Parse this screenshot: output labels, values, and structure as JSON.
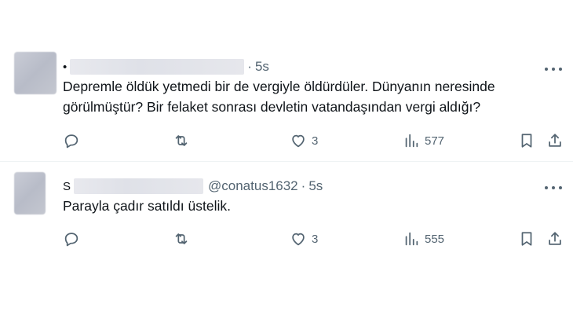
{
  "tweets": [
    {
      "author_initial": "•",
      "handle": "",
      "time": "5s",
      "lines": [
        "Depremle öldük yetmedi bir de vergiyle öldürdüler. Dünyanın neresinde",
        "görülmüştür? Bir felaket sonrası devletin vatandaşından vergi aldığı?"
      ],
      "likes": "3",
      "views": "577"
    },
    {
      "author_initial": "S",
      "handle": "@conatus1632",
      "time": "5s",
      "lines": [
        "Parayla çadır satıldı üstelik."
      ],
      "likes": "3",
      "views": "555"
    }
  ],
  "icons": {
    "reply": "reply-icon",
    "retweet": "retweet-icon",
    "like": "heart-icon",
    "views": "views-chart-icon",
    "bookmark": "bookmark-icon",
    "share": "share-icon",
    "more": "more-dots-icon"
  },
  "colors": {
    "text": "#0f1419",
    "secondary": "#536471",
    "divider": "#eff3f4"
  }
}
